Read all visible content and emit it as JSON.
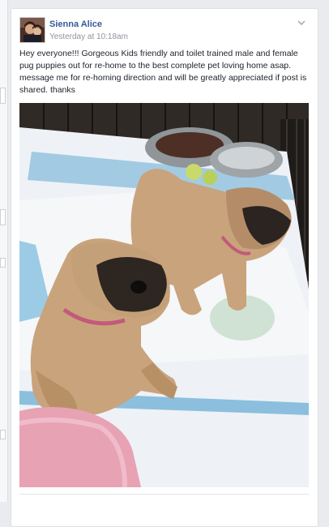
{
  "post": {
    "author": "Sienna Alice",
    "timestamp": "Yesterday at 10:18am",
    "text": "Hey everyone!!! Gorgeous Kids friendly and toilet trained male and female pug puppies out for re-home to the best complete pet loving home asap. message me for re-homing direction and will be greatly appreciated if post is shared. thanks",
    "photo_subject": "two-pug-puppies-photo"
  },
  "colors": {
    "author_link": "#365899",
    "meta_gray": "#90949c",
    "page_bg": "#e9ebee"
  },
  "icons": {
    "options": "chevron-down-icon"
  }
}
